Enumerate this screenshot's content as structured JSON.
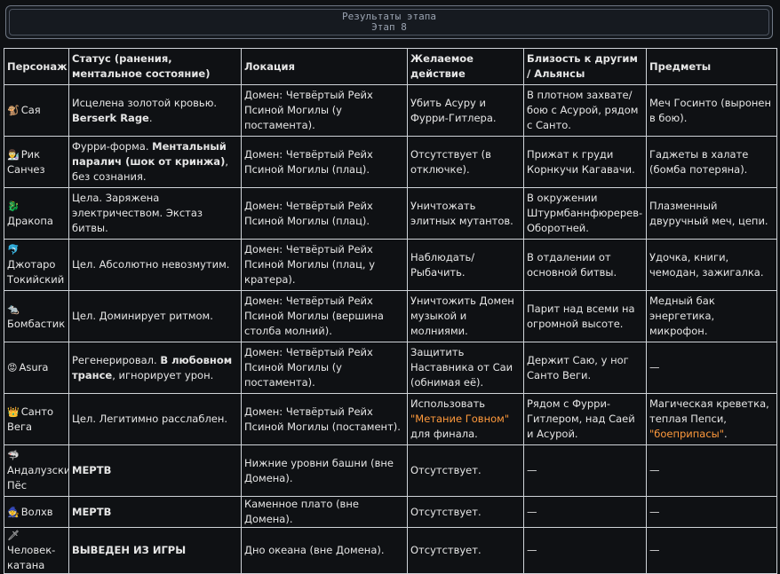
{
  "header": {
    "line1": "Результаты этапа",
    "line2": "Этап 8"
  },
  "table": {
    "headers": [
      "Персонаж",
      "Статус (ранения, ментальное состояние)",
      "Локация",
      "Желаемое действие",
      "Близость к другим / Альянсы",
      "Предметы"
    ],
    "rows": [
      {
        "icon": "🐒",
        "icon_name": "monkey-icon",
        "name": "Сая",
        "status_pre": "Исцелена золотой кровью. ",
        "status_bold": "Berserk Rage",
        "status_post": ".",
        "location": "Домен: Четвёртый Рейх Псиной Могилы (у постамента).",
        "action_pre": "Убить Асуру и Фурри-Гитлера.",
        "action_hl": "",
        "action_post": "",
        "proximity": "В плотном захвате/бою с Асурой, рядом с Санто.",
        "items_pre": "Меч Госинто (выронен в бою).",
        "items_hl": "",
        "items_post": ""
      },
      {
        "icon": "👨‍🔬",
        "icon_name": "scientist-icon",
        "name": "Рик Санчез",
        "status_pre": "Фурри-форма. ",
        "status_bold": "Ментальный паралич (шок от кринжа)",
        "status_post": ", без сознания.",
        "location": "Домен: Четвёртый Рейх Псиной Могилы (плац).",
        "action_pre": "Отсутствует (в отключке).",
        "action_hl": "",
        "action_post": "",
        "proximity": "Прижат к груди Корнкучи Кагавачи.",
        "items_pre": "Гаджеты в халате (бомба потеряна).",
        "items_hl": "",
        "items_post": ""
      },
      {
        "icon": "🐉",
        "icon_name": "dragon-icon",
        "name": "Дракопа",
        "status_pre": "Цела. Заряжена электричеством. Экстаз битвы.",
        "status_bold": "",
        "status_post": "",
        "location": "Домен: Четвёртый Рейх Псиной Могилы (плац).",
        "action_pre": "Уничтожать элитных мутантов.",
        "action_hl": "",
        "action_post": "",
        "proximity": "В окружении Штурмбаннфюререв-Оборотней.",
        "items_pre": "Плазменный двуручный меч, цепи.",
        "items_hl": "",
        "items_post": ""
      },
      {
        "icon": "🐬",
        "icon_name": "dolphin-icon",
        "name": "Джотаро Токийский",
        "status_pre": "Цел. Абсолютно невозмутим.",
        "status_bold": "",
        "status_post": "",
        "location": "Домен: Четвёртый Рейх Псиной Могилы (плац, у кратера).",
        "action_pre": "Наблюдать/ Рыбачить.",
        "action_hl": "",
        "action_post": "",
        "proximity": "В отдалении от основной битвы.",
        "items_pre": "Удочка, книги, чемодан, зажигалка.",
        "items_hl": "",
        "items_post": ""
      },
      {
        "icon": "🐀",
        "icon_name": "rat-icon",
        "name": "Бомбастик",
        "status_pre": "Цел. Доминирует ритмом.",
        "status_bold": "",
        "status_post": "",
        "location": "Домен: Четвёртый Рейх Псиной Могилы (вершина столба молний).",
        "action_pre": "Уничтожить Домен музыкой и молниями.",
        "action_hl": "",
        "action_post": "",
        "proximity": "Парит над всеми на огромной высоте.",
        "items_pre": "Медный бак энергетика, микрофон.",
        "items_hl": "",
        "items_post": ""
      },
      {
        "icon": "😡",
        "icon_name": "angry-face-icon",
        "name": "Asura",
        "status_pre": "Регенерировал. ",
        "status_bold": "В любовном трансе",
        "status_post": ", игнорирует урон.",
        "location": "Домен: Четвёртый Рейх Псиной Могилы (у постамента).",
        "action_pre": "Защитить Наставника от Саи (обнимая её).",
        "action_hl": "",
        "action_post": "",
        "proximity": "Держит Саю, у ног Санто Веги.",
        "items_pre": "—",
        "items_hl": "",
        "items_post": ""
      },
      {
        "icon": "👑",
        "icon_name": "crown-icon",
        "name": "Санто Вега",
        "status_pre": "Цел. Легитимно расслаблен.",
        "status_bold": "",
        "status_post": "",
        "location": "Домен: Четвёртый Рейх Псиной Могилы (постамент).",
        "action_pre": "Использовать ",
        "action_hl": "\"Метание Говном\"",
        "action_post": " для финала.",
        "proximity": "Рядом с Фурри-Гитлером, над Саей и Асурой.",
        "items_pre": "Магическая креветка, теплая Пепси, ",
        "items_hl": "\"боеприпасы\"",
        "items_post": "."
      },
      {
        "icon": "🦈",
        "icon_name": "shark-icon",
        "name": "Андалузский Пёс",
        "status_pre": "",
        "status_bold": "МЕРТВ",
        "status_post": "",
        "location": "Нижние уровни башни (вне Домена).",
        "action_pre": "Отсутствует.",
        "action_hl": "",
        "action_post": "",
        "proximity": "—",
        "items_pre": "—",
        "items_hl": "",
        "items_post": ""
      },
      {
        "icon": "🧙",
        "icon_name": "wizard-icon",
        "name": "Волхв",
        "status_pre": "",
        "status_bold": "МЕРТВ",
        "status_post": "",
        "location": "Каменное плато (вне Домена).",
        "action_pre": "Отсутствует.",
        "action_hl": "",
        "action_post": "",
        "proximity": "—",
        "items_pre": "—",
        "items_hl": "",
        "items_post": ""
      },
      {
        "icon": "🗡",
        "icon_name": "sword-icon",
        "name": "Человек-катана",
        "status_pre": "",
        "status_bold": "ВЫВЕДЕН ИЗ ИГРЫ",
        "status_post": "",
        "location": "Дно океана (вне Домена).",
        "action_pre": "Отсутствует.",
        "action_hl": "",
        "action_post": "",
        "proximity": "—",
        "items_pre": "—",
        "items_hl": "",
        "items_post": ""
      }
    ]
  },
  "colors": {
    "background": "#0f1114",
    "text": "#e6e6e6",
    "border": "#cfd3d8",
    "highlight": "#ff9a3c",
    "header_text": "#9aa3b1"
  }
}
